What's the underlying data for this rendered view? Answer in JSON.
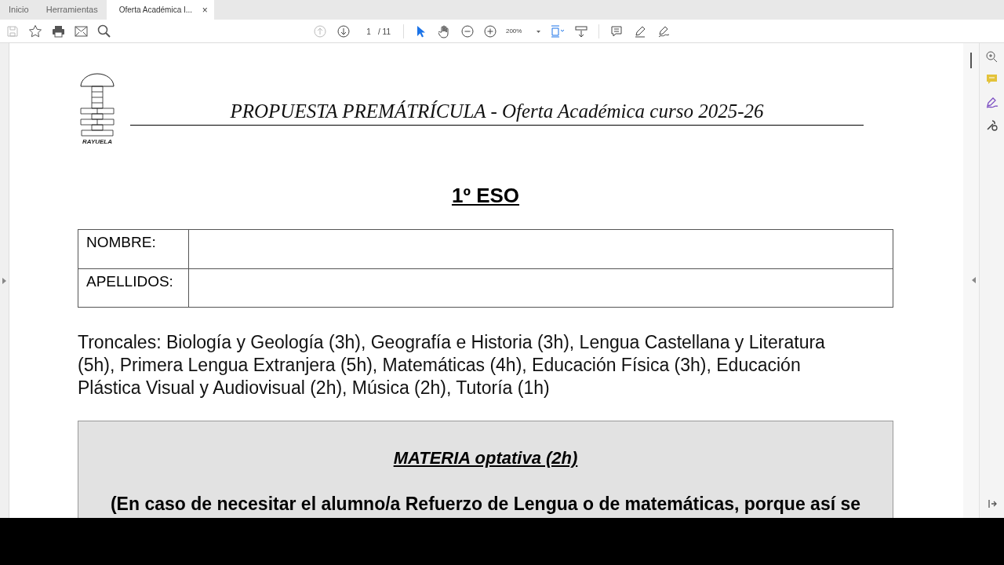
{
  "tabs": [
    {
      "label": "Inicio",
      "selected": false
    },
    {
      "label": "Herramientas",
      "selected": false
    },
    {
      "label": "Oferta Académica I...",
      "selected": true,
      "close": "×"
    }
  ],
  "toolbar": {
    "page_current": "1",
    "page_total": "/ 11",
    "zoom": "200%"
  },
  "document": {
    "logo_caption": "RAYUELA",
    "header_title": "PROPUESTA PREMÁTRÍCULA - Oferta Académica curso 2025-26",
    "heading": "1º ESO",
    "form_rows": [
      {
        "label": "NOMBRE:"
      },
      {
        "label": "APELLIDOS:"
      }
    ],
    "troncales": "Troncales: Biología y Geología (3h), Geografía e Historia (3h), Lengua Castellana y Literatura (5h), Primera Lengua Extranjera (5h), Matemáticas (4h), Educación Física (3h), Educación Plástica Visual y Audiovisual (2h), Música (2h), Tutoría (1h)",
    "optativa_heading": "MATERIA optativa (2h)",
    "optativa_note": "(En caso de necesitar el alumno/a Refuerzo de Lengua o de matemáticas, porque así se"
  }
}
